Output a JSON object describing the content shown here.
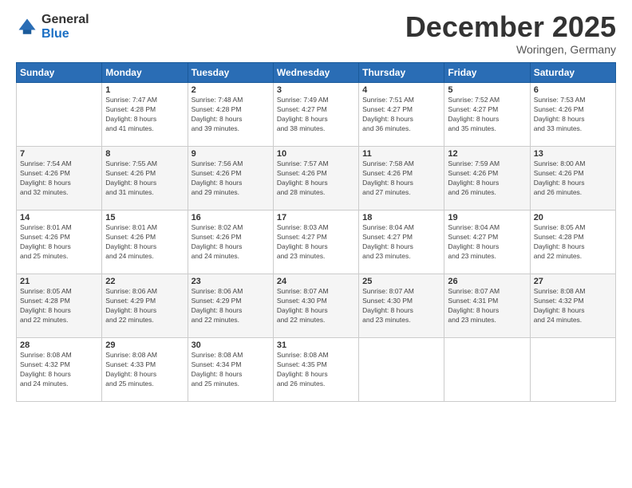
{
  "logo": {
    "general": "General",
    "blue": "Blue"
  },
  "header": {
    "month": "December 2025",
    "location": "Woringen, Germany"
  },
  "weekdays": [
    "Sunday",
    "Monday",
    "Tuesday",
    "Wednesday",
    "Thursday",
    "Friday",
    "Saturday"
  ],
  "weeks": [
    [
      {
        "day": "",
        "sunrise": "",
        "sunset": "",
        "daylight": ""
      },
      {
        "day": "1",
        "sunrise": "Sunrise: 7:47 AM",
        "sunset": "Sunset: 4:28 PM",
        "daylight": "Daylight: 8 hours and 41 minutes."
      },
      {
        "day": "2",
        "sunrise": "Sunrise: 7:48 AM",
        "sunset": "Sunset: 4:28 PM",
        "daylight": "Daylight: 8 hours and 39 minutes."
      },
      {
        "day": "3",
        "sunrise": "Sunrise: 7:49 AM",
        "sunset": "Sunset: 4:27 PM",
        "daylight": "Daylight: 8 hours and 38 minutes."
      },
      {
        "day": "4",
        "sunrise": "Sunrise: 7:51 AM",
        "sunset": "Sunset: 4:27 PM",
        "daylight": "Daylight: 8 hours and 36 minutes."
      },
      {
        "day": "5",
        "sunrise": "Sunrise: 7:52 AM",
        "sunset": "Sunset: 4:27 PM",
        "daylight": "Daylight: 8 hours and 35 minutes."
      },
      {
        "day": "6",
        "sunrise": "Sunrise: 7:53 AM",
        "sunset": "Sunset: 4:26 PM",
        "daylight": "Daylight: 8 hours and 33 minutes."
      }
    ],
    [
      {
        "day": "7",
        "sunrise": "Sunrise: 7:54 AM",
        "sunset": "Sunset: 4:26 PM",
        "daylight": "Daylight: 8 hours and 32 minutes."
      },
      {
        "day": "8",
        "sunrise": "Sunrise: 7:55 AM",
        "sunset": "Sunset: 4:26 PM",
        "daylight": "Daylight: 8 hours and 31 minutes."
      },
      {
        "day": "9",
        "sunrise": "Sunrise: 7:56 AM",
        "sunset": "Sunset: 4:26 PM",
        "daylight": "Daylight: 8 hours and 29 minutes."
      },
      {
        "day": "10",
        "sunrise": "Sunrise: 7:57 AM",
        "sunset": "Sunset: 4:26 PM",
        "daylight": "Daylight: 8 hours and 28 minutes."
      },
      {
        "day": "11",
        "sunrise": "Sunrise: 7:58 AM",
        "sunset": "Sunset: 4:26 PM",
        "daylight": "Daylight: 8 hours and 27 minutes."
      },
      {
        "day": "12",
        "sunrise": "Sunrise: 7:59 AM",
        "sunset": "Sunset: 4:26 PM",
        "daylight": "Daylight: 8 hours and 26 minutes."
      },
      {
        "day": "13",
        "sunrise": "Sunrise: 8:00 AM",
        "sunset": "Sunset: 4:26 PM",
        "daylight": "Daylight: 8 hours and 26 minutes."
      }
    ],
    [
      {
        "day": "14",
        "sunrise": "Sunrise: 8:01 AM",
        "sunset": "Sunset: 4:26 PM",
        "daylight": "Daylight: 8 hours and 25 minutes."
      },
      {
        "day": "15",
        "sunrise": "Sunrise: 8:01 AM",
        "sunset": "Sunset: 4:26 PM",
        "daylight": "Daylight: 8 hours and 24 minutes."
      },
      {
        "day": "16",
        "sunrise": "Sunrise: 8:02 AM",
        "sunset": "Sunset: 4:26 PM",
        "daylight": "Daylight: 8 hours and 24 minutes."
      },
      {
        "day": "17",
        "sunrise": "Sunrise: 8:03 AM",
        "sunset": "Sunset: 4:27 PM",
        "daylight": "Daylight: 8 hours and 23 minutes."
      },
      {
        "day": "18",
        "sunrise": "Sunrise: 8:04 AM",
        "sunset": "Sunset: 4:27 PM",
        "daylight": "Daylight: 8 hours and 23 minutes."
      },
      {
        "day": "19",
        "sunrise": "Sunrise: 8:04 AM",
        "sunset": "Sunset: 4:27 PM",
        "daylight": "Daylight: 8 hours and 23 minutes."
      },
      {
        "day": "20",
        "sunrise": "Sunrise: 8:05 AM",
        "sunset": "Sunset: 4:28 PM",
        "daylight": "Daylight: 8 hours and 22 minutes."
      }
    ],
    [
      {
        "day": "21",
        "sunrise": "Sunrise: 8:05 AM",
        "sunset": "Sunset: 4:28 PM",
        "daylight": "Daylight: 8 hours and 22 minutes."
      },
      {
        "day": "22",
        "sunrise": "Sunrise: 8:06 AM",
        "sunset": "Sunset: 4:29 PM",
        "daylight": "Daylight: 8 hours and 22 minutes."
      },
      {
        "day": "23",
        "sunrise": "Sunrise: 8:06 AM",
        "sunset": "Sunset: 4:29 PM",
        "daylight": "Daylight: 8 hours and 22 minutes."
      },
      {
        "day": "24",
        "sunrise": "Sunrise: 8:07 AM",
        "sunset": "Sunset: 4:30 PM",
        "daylight": "Daylight: 8 hours and 22 minutes."
      },
      {
        "day": "25",
        "sunrise": "Sunrise: 8:07 AM",
        "sunset": "Sunset: 4:30 PM",
        "daylight": "Daylight: 8 hours and 23 minutes."
      },
      {
        "day": "26",
        "sunrise": "Sunrise: 8:07 AM",
        "sunset": "Sunset: 4:31 PM",
        "daylight": "Daylight: 8 hours and 23 minutes."
      },
      {
        "day": "27",
        "sunrise": "Sunrise: 8:08 AM",
        "sunset": "Sunset: 4:32 PM",
        "daylight": "Daylight: 8 hours and 24 minutes."
      }
    ],
    [
      {
        "day": "28",
        "sunrise": "Sunrise: 8:08 AM",
        "sunset": "Sunset: 4:32 PM",
        "daylight": "Daylight: 8 hours and 24 minutes."
      },
      {
        "day": "29",
        "sunrise": "Sunrise: 8:08 AM",
        "sunset": "Sunset: 4:33 PM",
        "daylight": "Daylight: 8 hours and 25 minutes."
      },
      {
        "day": "30",
        "sunrise": "Sunrise: 8:08 AM",
        "sunset": "Sunset: 4:34 PM",
        "daylight": "Daylight: 8 hours and 25 minutes."
      },
      {
        "day": "31",
        "sunrise": "Sunrise: 8:08 AM",
        "sunset": "Sunset: 4:35 PM",
        "daylight": "Daylight: 8 hours and 26 minutes."
      },
      {
        "day": "",
        "sunrise": "",
        "sunset": "",
        "daylight": ""
      },
      {
        "day": "",
        "sunrise": "",
        "sunset": "",
        "daylight": ""
      },
      {
        "day": "",
        "sunrise": "",
        "sunset": "",
        "daylight": ""
      }
    ]
  ]
}
